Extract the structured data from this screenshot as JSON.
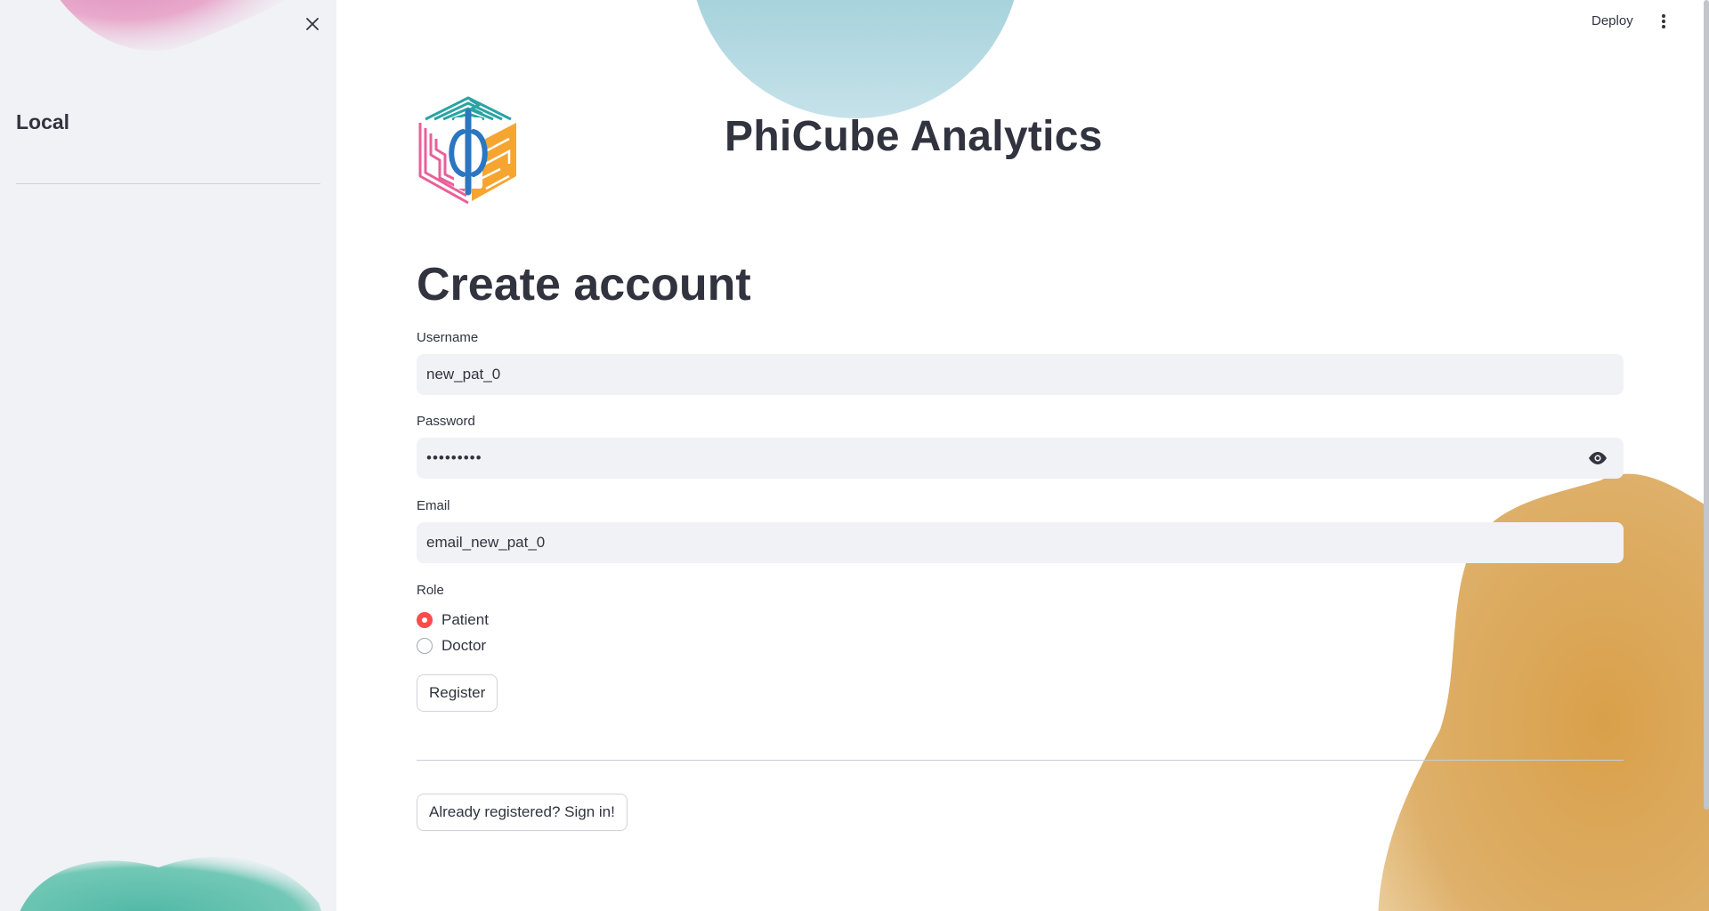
{
  "sidebar": {
    "title": "Local",
    "close_icon": "close-icon"
  },
  "toolbar": {
    "deploy_label": "Deploy",
    "menu_icon": "more-vertical-icon"
  },
  "header": {
    "brand_title": "PhiCube Analytics",
    "logo_icon": "phicube-logo"
  },
  "form": {
    "title": "Create account",
    "username": {
      "label": "Username",
      "value": "new_pat_0"
    },
    "password": {
      "label": "Password",
      "value": "•••••••••",
      "toggle_icon": "eye-icon"
    },
    "email": {
      "label": "Email",
      "value": "email_new_pat_0"
    },
    "role": {
      "label": "Role",
      "options": [
        {
          "label": "Patient",
          "selected": true
        },
        {
          "label": "Doctor",
          "selected": false
        }
      ]
    },
    "register_label": "Register",
    "signin_label": "Already registered? Sign in!"
  },
  "colors": {
    "accent": "#ff4b4b",
    "sidebar_bg": "#f0f2f6",
    "input_bg": "#f0f2f6",
    "text": "#31333f"
  }
}
